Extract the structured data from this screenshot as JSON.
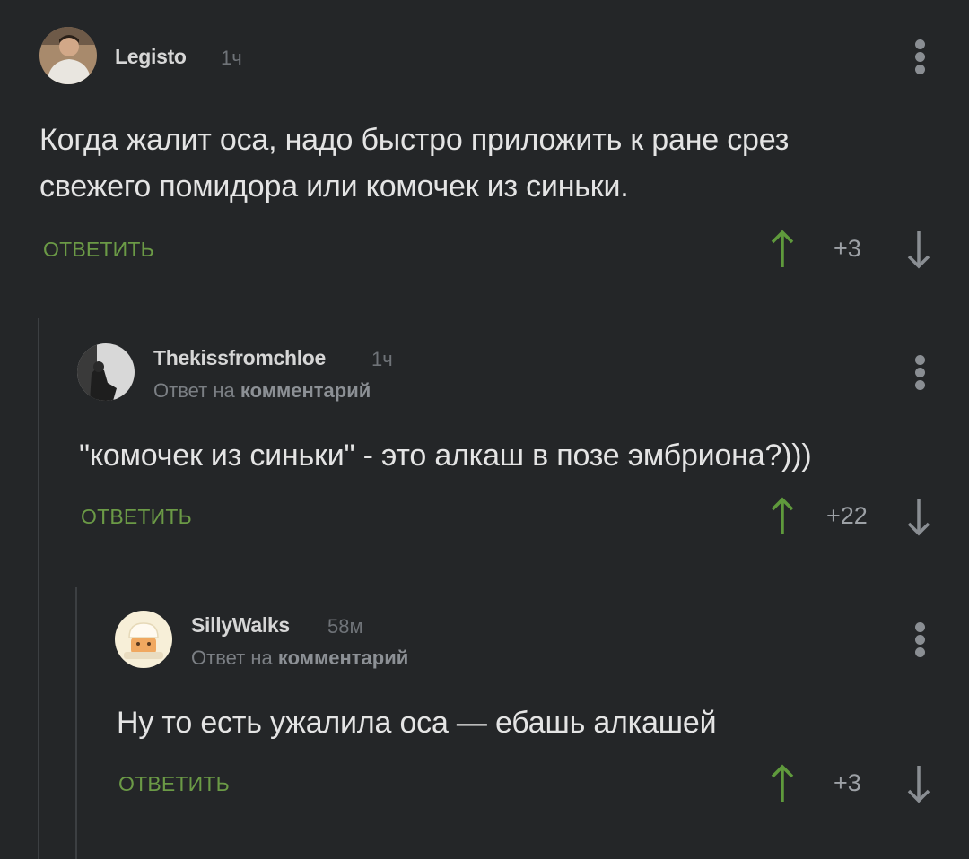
{
  "comments": [
    {
      "author": "Legisto",
      "time": "1ч",
      "text_lines": [
        "Когда жалит оса, надо быстро приложить к ране срез",
        "свежего помидора или  комочек из синьки."
      ],
      "reply_label": "ОТВЕТИТЬ",
      "rating": "+3"
    },
    {
      "author": "Thekissfromchloe",
      "time": "1ч",
      "reply_to_prefix": "Ответ на",
      "reply_to_link": "комментарий",
      "text_lines": [
        "\"комочек из синьки\" - это алкаш в позе эмбриона?)))"
      ],
      "reply_label": "ОТВЕТИТЬ",
      "rating": "+22"
    },
    {
      "author": "SillyWalks",
      "time": "58м",
      "reply_to_prefix": "Ответ на",
      "reply_to_link": "комментарий",
      "text_lines": [
        "Ну то есть ужалила оса — ебашь алкашей"
      ],
      "reply_label": "ОТВЕТИТЬ",
      "rating": "+3"
    }
  ],
  "colors": {
    "background": "#242628",
    "reply_green": "#6b9a46",
    "upvote_green": "#5f9a3c",
    "downvote_gray": "#8a8e93"
  },
  "icons": {
    "upvote": "arrow-up-icon",
    "downvote": "arrow-down-icon",
    "menu": "kebab-menu-icon"
  }
}
